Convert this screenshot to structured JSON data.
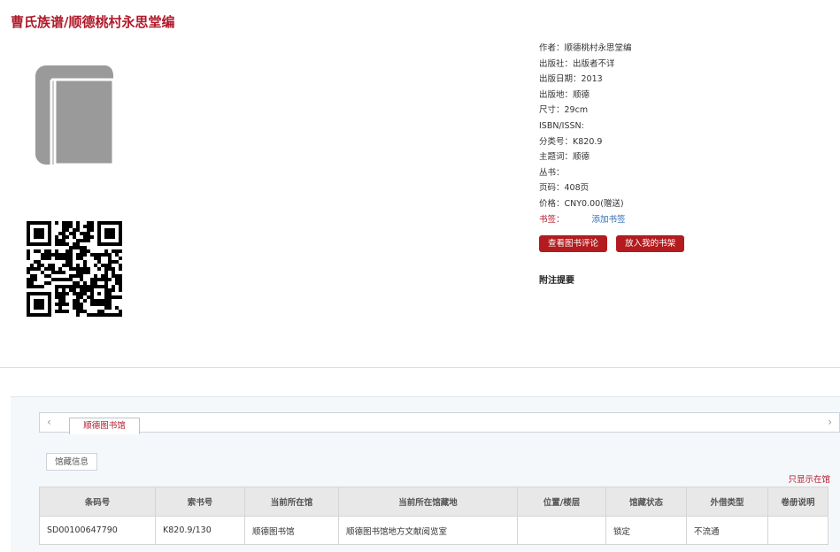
{
  "book": {
    "title": "曹氏族谱/顺德桃村永思堂编",
    "metadata": [
      {
        "label": "作者：",
        "value": "顺德桃村永思堂编"
      },
      {
        "label": "出版社：",
        "value": "出版者不详"
      },
      {
        "label": "出版日期：",
        "value": "2013"
      },
      {
        "label": "出版地：",
        "value": "顺德"
      },
      {
        "label": "尺寸：",
        "value": "29cm"
      },
      {
        "label": "ISBN/ISSN:",
        "value": ""
      },
      {
        "label": "分类号：",
        "value": "K820.9"
      },
      {
        "label": "主题词：",
        "value": "顺德"
      },
      {
        "label": "丛书：",
        "value": ""
      },
      {
        "label": "页码：",
        "value": "408页"
      },
      {
        "label": "价格：",
        "value": "CNY0.00(赠送)"
      }
    ],
    "tags_label": "书签：",
    "add_tag_link": "添加书签"
  },
  "actions": {
    "view_reviews": "查看图书评论",
    "add_to_shelf": "放入我的书架"
  },
  "notes_heading": "附注提要",
  "holdings": {
    "library_tab": "顺德图书馆",
    "subtab": "馆藏信息",
    "only_show_link": "只显示在馆",
    "columns": [
      "条码号",
      "索书号",
      "当前所在馆",
      "当前所在馆藏地",
      "位置/楼层",
      "馆藏状态",
      "外借类型",
      "卷册说明"
    ],
    "rows": [
      [
        "SD00100647790",
        "K820.9/130",
        "顺德图书馆",
        "顺德图书馆地方文献阅览室",
        "",
        "锁定",
        "不流通",
        ""
      ]
    ]
  },
  "colors": {
    "accent": "#b0192a",
    "button": "#b31b1e",
    "link": "#2d6ab5"
  },
  "icons": {
    "cover": "book-icon",
    "qr": "qr-code-icon"
  }
}
